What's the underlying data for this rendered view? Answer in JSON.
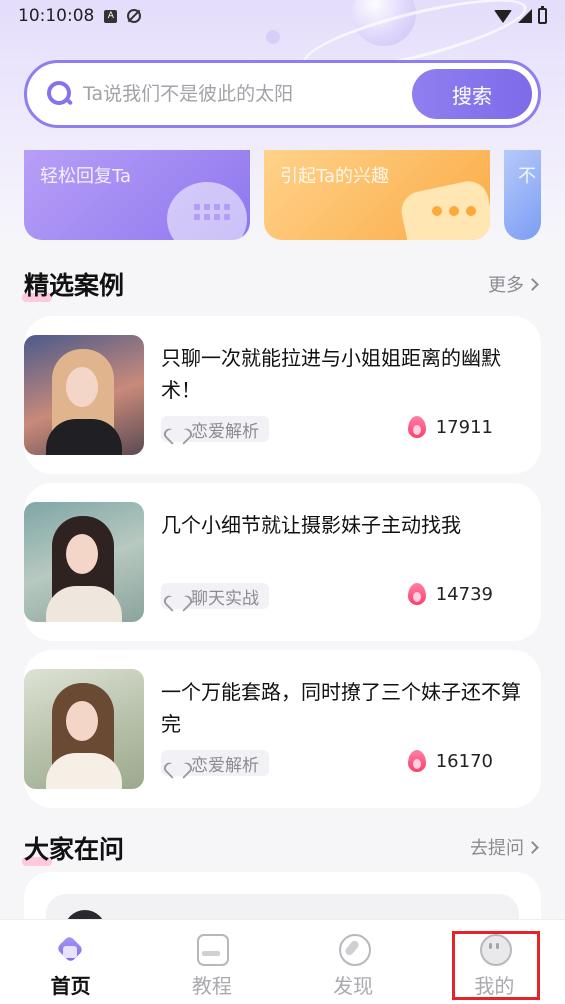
{
  "status_bar": {
    "time": "10:10:08",
    "icons": [
      "notification-a-icon",
      "sync-off-icon",
      "wifi-icon",
      "signal-icon",
      "battery-icon"
    ]
  },
  "search": {
    "placeholder": "Ta说我们不是彼此的太阳",
    "button_label": "搜索"
  },
  "tools": [
    {
      "label": "轻松回复Ta",
      "icon": "keyboard-icon"
    },
    {
      "label": "引起Ta的兴趣",
      "icon": "chat-bubble-icon"
    },
    {
      "label": "不",
      "icon": ""
    }
  ],
  "featured": {
    "title": "精选案例",
    "more_label": "更多",
    "cases": [
      {
        "title": "只聊一次就能拉进与小姐姐距离的幽默术！",
        "tag": "恋爱解析",
        "hot": "17911"
      },
      {
        "title": "几个小细节就让摄影妹子主动找我",
        "tag": "聊天实战",
        "hot": "14739"
      },
      {
        "title": "一个万能套路，同时撩了三个妹子还不算完",
        "tag": "恋爱解析",
        "hot": "16170"
      }
    ]
  },
  "qa": {
    "title": "大家在问",
    "more_label": "去提问"
  },
  "tabbar": {
    "tabs": [
      {
        "label": "首页",
        "icon": "home-icon",
        "active": true
      },
      {
        "label": "教程",
        "icon": "book-icon",
        "active": false
      },
      {
        "label": "发现",
        "icon": "compass-icon",
        "active": false
      },
      {
        "label": "我的",
        "icon": "profile-icon",
        "active": false
      }
    ]
  },
  "colors": {
    "accent": "#8673ea",
    "highlight_box": "#e5232a",
    "flame": "#ff3d6e"
  }
}
